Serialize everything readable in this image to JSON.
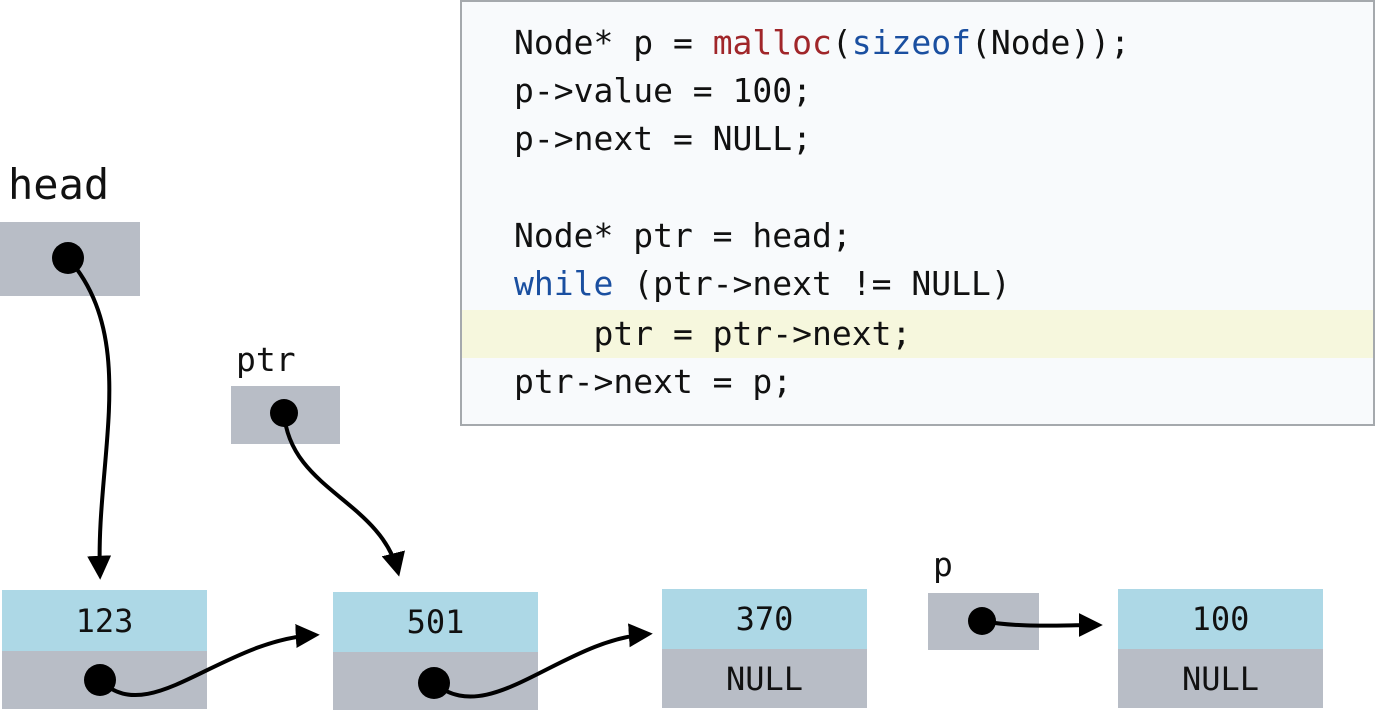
{
  "code": {
    "lines": [
      {
        "segments": [
          {
            "text": "Node* p = ",
            "cls": ""
          },
          {
            "text": "malloc",
            "cls": "fn"
          },
          {
            "text": "(",
            "cls": ""
          },
          {
            "text": "sizeof",
            "cls": "kw"
          },
          {
            "text": "(Node));",
            "cls": ""
          }
        ]
      },
      {
        "segments": [
          {
            "text": "p->value = 100;",
            "cls": ""
          }
        ]
      },
      {
        "segments": [
          {
            "text": "p->next = NULL;",
            "cls": ""
          }
        ]
      },
      {
        "segments": [
          {
            "text": "",
            "cls": ""
          }
        ]
      },
      {
        "segments": [
          {
            "text": "Node* ptr = head;",
            "cls": ""
          }
        ]
      },
      {
        "segments": [
          {
            "text": "while",
            "cls": "kw"
          },
          {
            "text": " (ptr->next != NULL)",
            "cls": ""
          }
        ]
      },
      {
        "segments": [
          {
            "text": "    ptr = ptr->next;",
            "cls": ""
          }
        ],
        "highlighted": true
      },
      {
        "segments": [
          {
            "text": "ptr->next = p;",
            "cls": ""
          }
        ]
      }
    ],
    "colors": {
      "keyword": "#1a4fa0",
      "function": "#a0262a",
      "highlight": "#f6f7dd"
    }
  },
  "pointers": {
    "head": {
      "label": "head"
    },
    "ptr": {
      "label": "ptr"
    },
    "p": {
      "label": "p"
    }
  },
  "nodes": [
    {
      "value": "123",
      "next": ""
    },
    {
      "value": "501",
      "next": ""
    },
    {
      "value": "370",
      "next": "NULL"
    },
    {
      "value": "100",
      "next": "NULL"
    }
  ],
  "colors": {
    "value_cell": "#add8e6",
    "pointer_cell": "#b8bdc6"
  }
}
